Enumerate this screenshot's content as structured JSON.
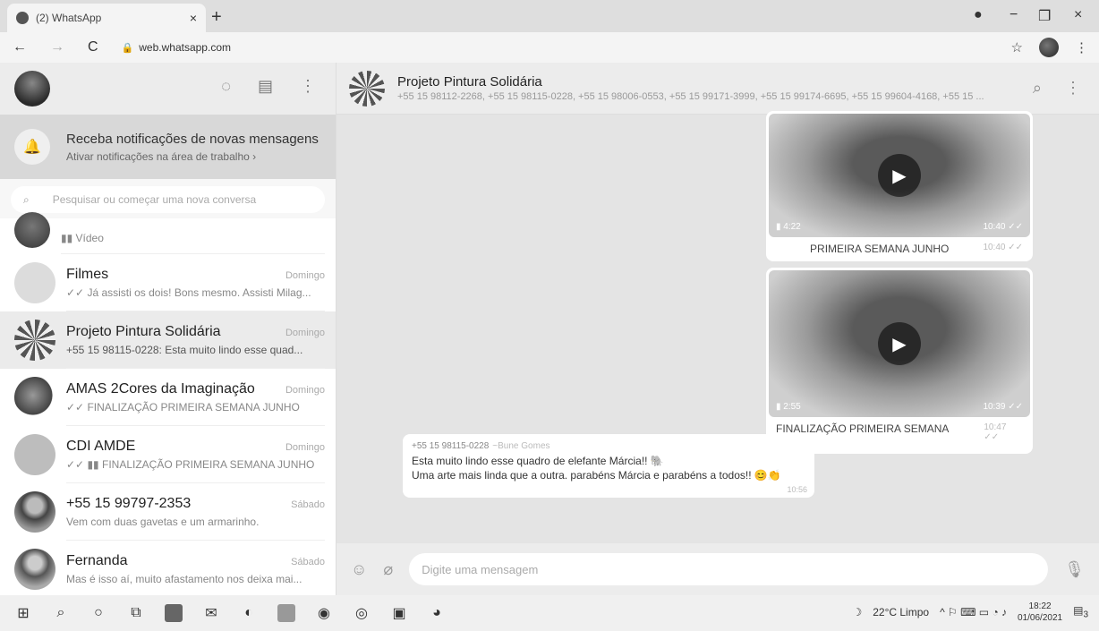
{
  "browser": {
    "tab_title": "(2) WhatsApp",
    "tab_close": "×",
    "new_tab": "+",
    "url": "web.whatsapp.com",
    "back": "←",
    "forward": "→",
    "reload": "C",
    "star": "☆",
    "menu": "⋮",
    "minimize": "−",
    "restore": "❐",
    "close": "×"
  },
  "sidebar": {
    "header_icons": {
      "status": "◌",
      "new_chat": "▤",
      "menu": "⋮"
    },
    "notification": {
      "title": "Receba notificações de novas mensagens",
      "subtitle": "Ativar notificações na área de trabalho ›"
    },
    "search_placeholder": "Pesquisar ou começar uma nova conversa",
    "chats": [
      {
        "name": "",
        "time": "",
        "message": "▮▮ Vídeo"
      },
      {
        "name": "Filmes",
        "time": "Domingo",
        "message": "✓✓ Já assisti os dois! Bons mesmo. Assisti Milag..."
      },
      {
        "name": "Projeto Pintura Solidária",
        "time": "Domingo",
        "message": "+55 15 98115-0228: Esta muito lindo esse quad..."
      },
      {
        "name": "AMAS 2Cores da Imaginação",
        "time": "Domingo",
        "message": "✓✓ FINALIZAÇÃO PRIMEIRA SEMANA JUNHO"
      },
      {
        "name": "CDI AMDE",
        "time": "Domingo",
        "message": "✓✓ ▮▮ FINALIZAÇÃO PRIMEIRA SEMANA JUNHO"
      },
      {
        "name": "+55 15 99797-2353",
        "time": "Sábado",
        "message": "Vem com duas gavetas e um armarinho."
      },
      {
        "name": "Fernanda",
        "time": "Sábado",
        "message": "Mas é isso aí, muito afastamento nos deixa mai..."
      }
    ]
  },
  "conversation": {
    "group_name": "Projeto Pintura Solidária",
    "members": "+55 15 98112-2268, +55 15 98115-0228, +55 15 98006-0553, +55 15 99171-3999, +55 15 99174-6695, +55 15 99604-4168, +55 15 ...",
    "search_icon": "⌕",
    "menu_icon": "⋮",
    "videos": [
      {
        "duration": "▮ 4:22",
        "time": "10:40 ✓✓",
        "caption": "PRIMEIRA SEMANA JUNHO",
        "caption_time": "10:40 ✓✓"
      },
      {
        "duration": "▮ 2:55",
        "time": "10:39 ✓✓",
        "caption": "FINALIZAÇÃO PRIMEIRA SEMANA JUNHO",
        "caption_time": "10:47 ✓✓"
      }
    ],
    "incoming": {
      "sender": "+55 15 98115-0228",
      "push_name": "~Bune Gomes",
      "line1": "Esta muito lindo esse quadro de elefante Márcia!! 🐘",
      "line2": "Uma arte mais linda que a outra. parabéns Márcia e parabéns a todos!! 😊👏",
      "time": "10:56"
    },
    "composer": {
      "emoji_icon": "☺",
      "attach_icon": "⌀",
      "placeholder": "Digite uma mensagem",
      "mic_icon": "🎙"
    }
  },
  "taskbar": {
    "weather": "22°C Limpo",
    "tray_icons": "^ ⚐ ⌨ ▭ ◔ ♪",
    "time": "18:22",
    "date": "01/06/2021",
    "notif_count": "3"
  }
}
